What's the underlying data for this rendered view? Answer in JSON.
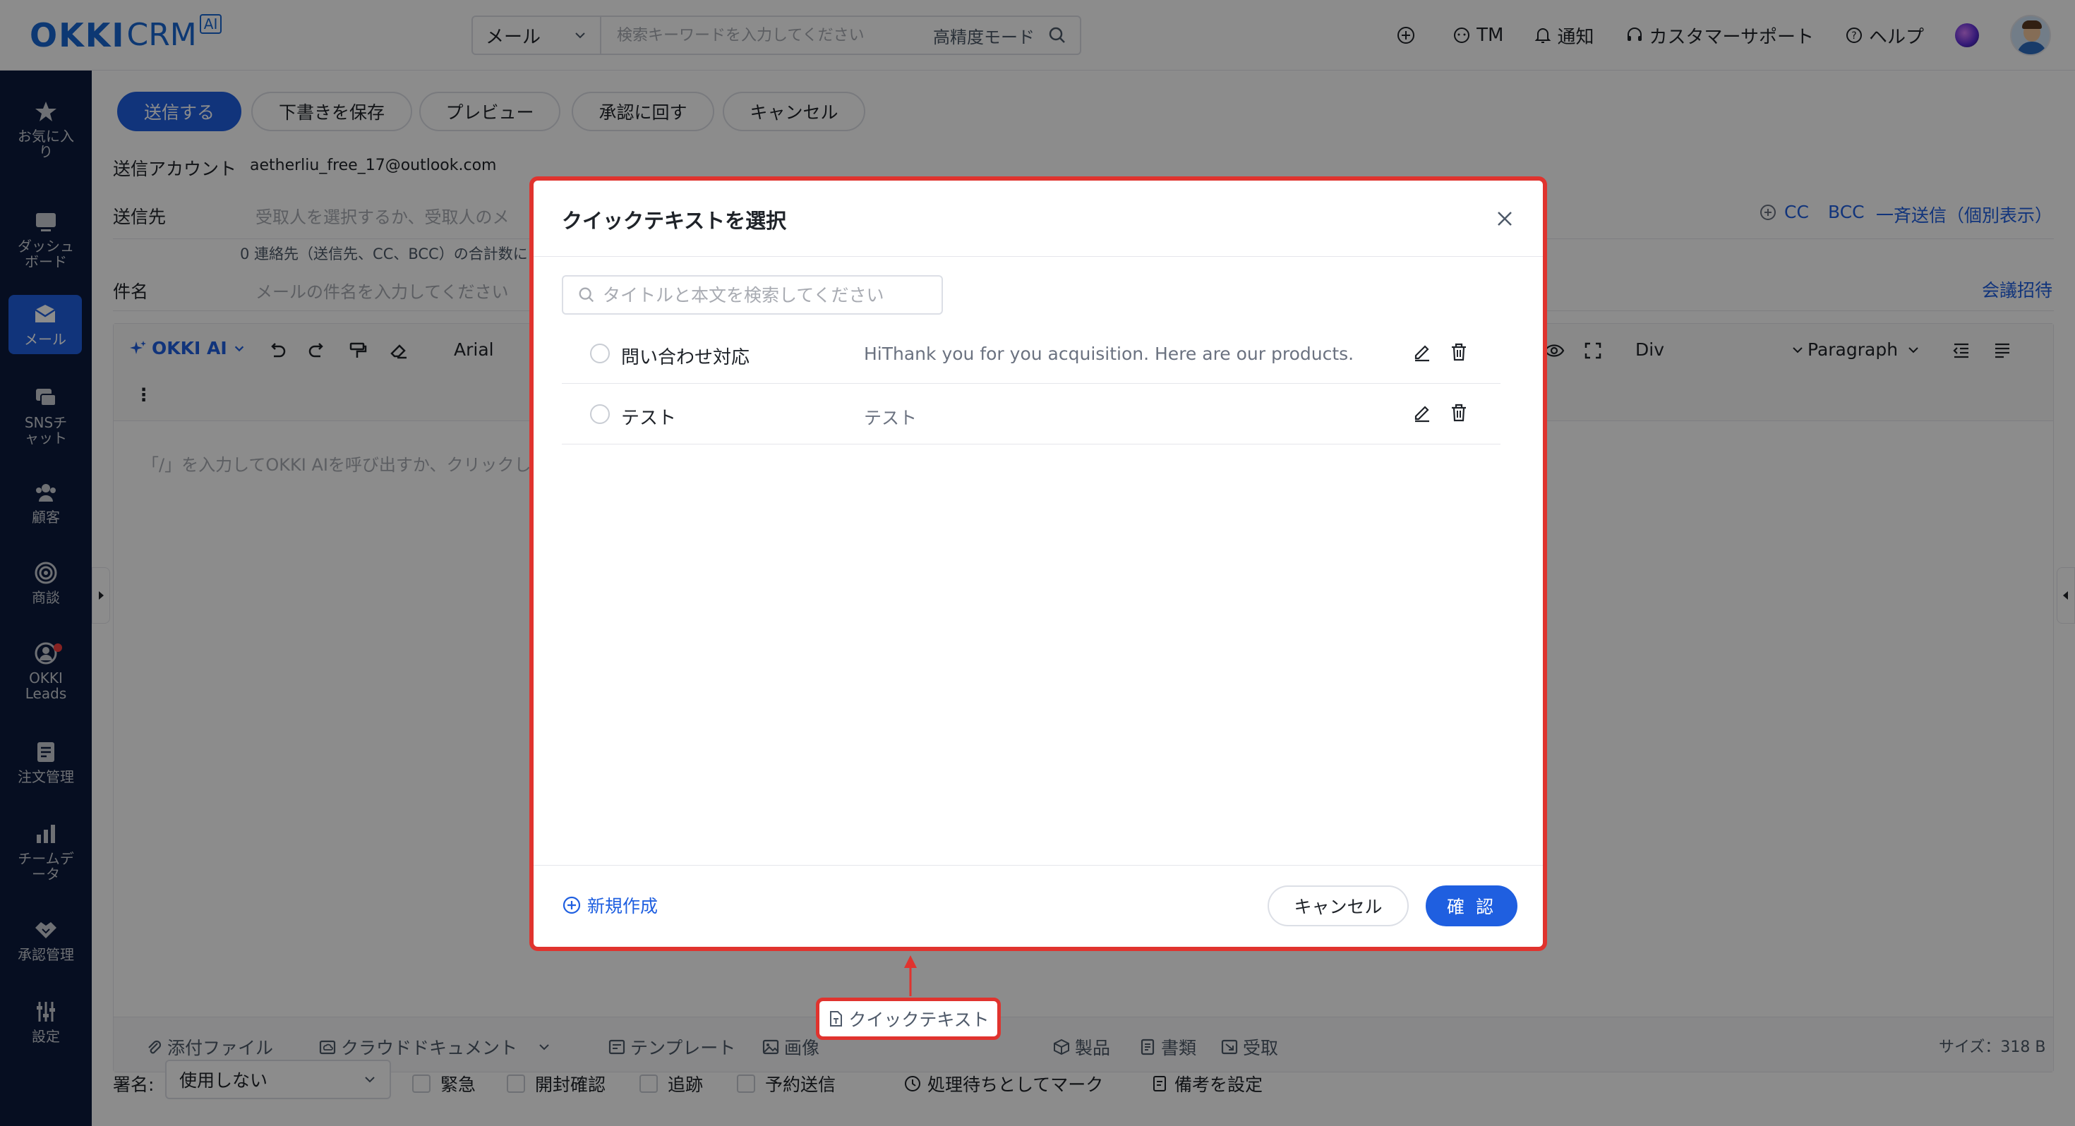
{
  "app": {
    "logo_main": "OKKI",
    "logo_sub": "CRM",
    "logo_badge": "AI"
  },
  "topbar": {
    "search_type": "メール",
    "search_placeholder": "検索キーワードを入力してください",
    "search_mode": "高精度モード",
    "actions": {
      "tm": "TM",
      "notify": "通知",
      "support": "カスタマーサポート",
      "help": "ヘルプ"
    }
  },
  "sidebar": {
    "items": [
      {
        "label": "お気に入り",
        "icon": "star-icon"
      },
      {
        "label": "ダッシュボード",
        "icon": "dashboard-icon"
      },
      {
        "label": "メール",
        "icon": "mail-icon"
      },
      {
        "label": "SNSチャット",
        "icon": "chat-icon"
      },
      {
        "label": "顧客",
        "icon": "customers-icon"
      },
      {
        "label": "商談",
        "icon": "target-icon"
      },
      {
        "label": "OKKI Leads",
        "icon": "leads-icon"
      },
      {
        "label": "注文管理",
        "icon": "order-icon"
      },
      {
        "label": "チームデータ",
        "icon": "chart-icon"
      },
      {
        "label": "承認管理",
        "icon": "handshake-icon"
      },
      {
        "label": "設定",
        "icon": "settings-icon"
      }
    ]
  },
  "compose": {
    "buttons": {
      "send": "送信する",
      "save_draft": "下書きを保存",
      "preview": "プレビュー",
      "approval": "承認に回す",
      "cancel": "キャンセル"
    },
    "account_label": "送信アカウント",
    "account_value": "aetherliu_free_17@outlook.com",
    "to_label": "送信先",
    "to_placeholder": "受取人を選択するか、受取人のメ",
    "cc": "CC",
    "bcc": "BCC",
    "bulk": "一斉送信（個別表示）",
    "contacts_note": "0 連絡先（送信先、CC、BCC）の合計数に",
    "subject_label": "件名",
    "subject_placeholder": "メールの件名を入力してください",
    "meeting_invite": "会議招待",
    "toolbar": {
      "ai": "OKKI AI",
      "font": "Arial",
      "block": "Div",
      "para": "Paragraph",
      "more": "⋮"
    },
    "editor_placeholder": "「/」を入力してOKKI AIを呼び出すか、クリックし",
    "bottom": {
      "attach": "添付ファイル",
      "cloud": "クラウドドキュメント",
      "template": "テンプレート",
      "image": "画像",
      "quicktext": "クイックテキスト",
      "product": "製品",
      "document": "書類",
      "receive": "受取",
      "size": "サイズ：318 B"
    },
    "footer": {
      "signature_label": "署名:",
      "signature_value": "使用しない",
      "urgent": "緊急",
      "read_receipt": "開封確認",
      "track": "追跡",
      "schedule": "予約送信",
      "mark_pending": "処理待ちとしてマーク",
      "note": "備考を設定"
    }
  },
  "modal": {
    "title": "クイックテキストを選択",
    "search_placeholder": "タイトルと本文を検索してください",
    "items": [
      {
        "title": "問い合わせ対応",
        "body": "HiThank you for you acquisition. Here are our products."
      },
      {
        "title": "テスト",
        "body": "テスト"
      }
    ],
    "new_link": "新規作成",
    "cancel": "キャンセル",
    "confirm": "確 認"
  },
  "colors": {
    "primary": "#1f5fe0",
    "sidebar": "#0b1a3c",
    "highlight": "#e0332e"
  }
}
